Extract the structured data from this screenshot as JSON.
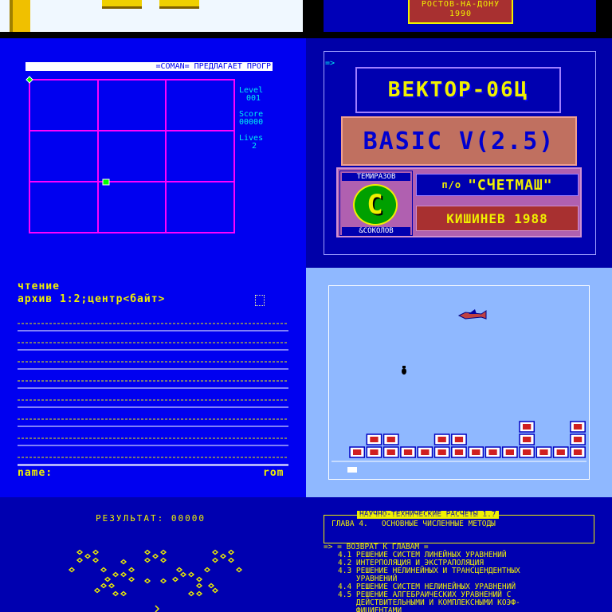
{
  "tiles": {
    "top_right": {
      "line1": "РОСТОВ-НА-ДОНУ",
      "line2": "1990"
    },
    "grid_game": {
      "banner": "=COMAN= ПРЕДЛАГАЕТ ПРОГР",
      "level_label": "Level",
      "level_value": "001",
      "score_label": "Score",
      "score_value": "00000",
      "lives_label": "Lives",
      "lives_value": "2"
    },
    "vector_title": {
      "prompt": "=>",
      "title": "ВЕКТОР-06Ц",
      "basic": "BASIC V(2.5)",
      "author1": "ТЕМИРАЗОВ",
      "author2": "&СОКОЛОВ",
      "logo_letter": "С",
      "company_prefix": "п/о",
      "company": "\"СЧЕТМАШ\"",
      "city_year": "КИШИНЕВ 1988"
    },
    "tape_loader": {
      "line1": "чтение",
      "line2": "архив 1:2;центр<байт>",
      "name_label": "name:",
      "rom_label": "rom"
    },
    "bomber_game": {
      "building_columns": [
        1,
        2,
        2,
        1,
        1,
        2,
        2,
        1,
        1,
        1,
        3,
        1,
        1,
        3
      ]
    },
    "dots_game": {
      "result_label": "РЕЗУЛЬТАТ:",
      "result_value": "00000"
    },
    "numeric_menu": {
      "header": "НАУЧНО-ТЕХНИЧЕСКИЕ РАСЧЕТЫ 1.7",
      "chapter": "ГЛАВА 4.   ОСНОВНЫЕ ЧИСЛЕННЫЕ МЕТОДЫ",
      "back": "=> = ВОЗВРАТ К ГЛАВАМ =",
      "items": [
        "4.1 РЕШЕНИЕ СИСТЕМ ЛИНЕЙНЫХ УРАВНЕНИЙ",
        "4.2 ИНТЕРПОЛЯЦИЯ И ЭКСТРАПОЛЯЦИЯ",
        "4.3 РЕШЕНИЕ НЕЛИНЕЙНЫХ И ТРАНСЦЕНДЕНТНЫХ",
        "    УРАВНЕНИЙ",
        "4.4 РЕШЕНИЕ СИСТЕМ НЕЛИНЕЙНЫХ УРАВНЕНИЙ",
        "4.5 РЕШЕНИЕ АЛГЕБРАИЧЕСКИХ УРАВНЕНИЙ С",
        "    ДЕЙСТВИТЕЛЬНЫМИ И КОМПЛЕКСНЫМИ КОЭФ-",
        "    ФИЦИЕНТАМИ"
      ]
    }
  },
  "colors": {
    "blue": "#0000f0",
    "dark_blue": "#0000a8",
    "yellow": "#f0f000",
    "magenta": "#ff00ff",
    "cyan": "#00f0f0",
    "light_blue": "#8fb8ff",
    "brown": "#c07060",
    "purple": "#b060b0"
  }
}
